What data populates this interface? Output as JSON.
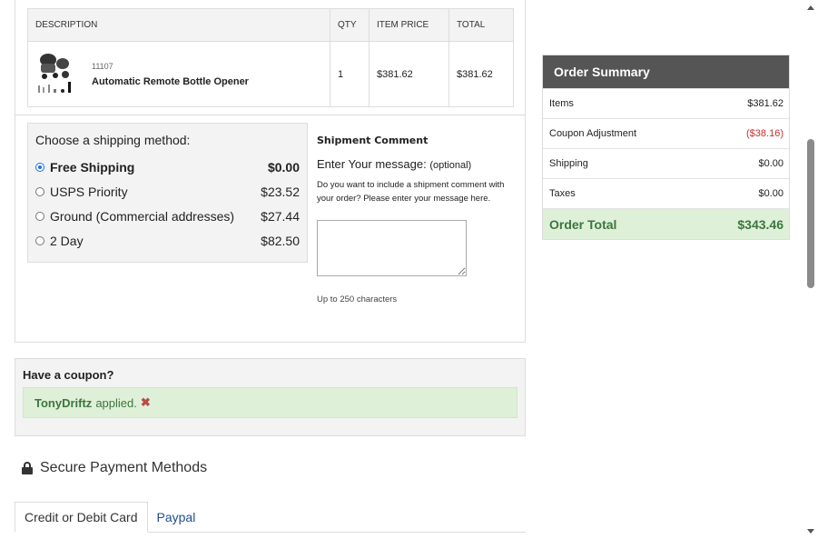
{
  "cart": {
    "headers": [
      "DESCRIPTION",
      "QTY",
      "ITEM PRICE",
      "TOTAL"
    ],
    "item": {
      "sku": "11107",
      "name": "Automatic Remote Bottle Opener",
      "qty": "1",
      "price": "$381.62",
      "total": "$381.62"
    }
  },
  "shipping": {
    "title": "Choose a shipping method:",
    "methods": [
      {
        "name": "Free Shipping",
        "price": "$0.00",
        "selected": true
      },
      {
        "name": "USPS Priority",
        "price": "$23.52",
        "selected": false
      },
      {
        "name": "Ground (Commercial addresses)",
        "price": "$27.44",
        "selected": false
      },
      {
        "name": "2 Day",
        "price": "$82.50",
        "selected": false
      }
    ]
  },
  "comment": {
    "title": "Shipment Comment",
    "label": "Enter Your message:",
    "optional": "(optional)",
    "help": "Do you want to include a shipment comment with your order? Please enter your message here.",
    "limit": "Up to 250 characters"
  },
  "coupon": {
    "title": "Have a coupon?",
    "code": "TonyDriftz",
    "applied_text": "applied.",
    "remove_icon": "close-icon"
  },
  "payment": {
    "title": "Secure Payment Methods",
    "icon": "lock-icon",
    "tabs": [
      "Credit or Debit Card",
      "Paypal"
    ]
  },
  "summary": {
    "title": "Order Summary",
    "rows": [
      {
        "label": "Items",
        "value": "$381.62"
      },
      {
        "label": "Coupon Adjustment",
        "value": "($38.16)"
      },
      {
        "label": "Shipping",
        "value": "$0.00"
      },
      {
        "label": "Taxes",
        "value": "$0.00"
      }
    ],
    "total_label": "Order Total",
    "total_value": "$343.46"
  },
  "colors": {
    "summary_header": "#555555",
    "total_bg": "#dff0d8",
    "total_text": "#3c763d",
    "negative": "#c9302c",
    "link": "#1f4e8c"
  }
}
